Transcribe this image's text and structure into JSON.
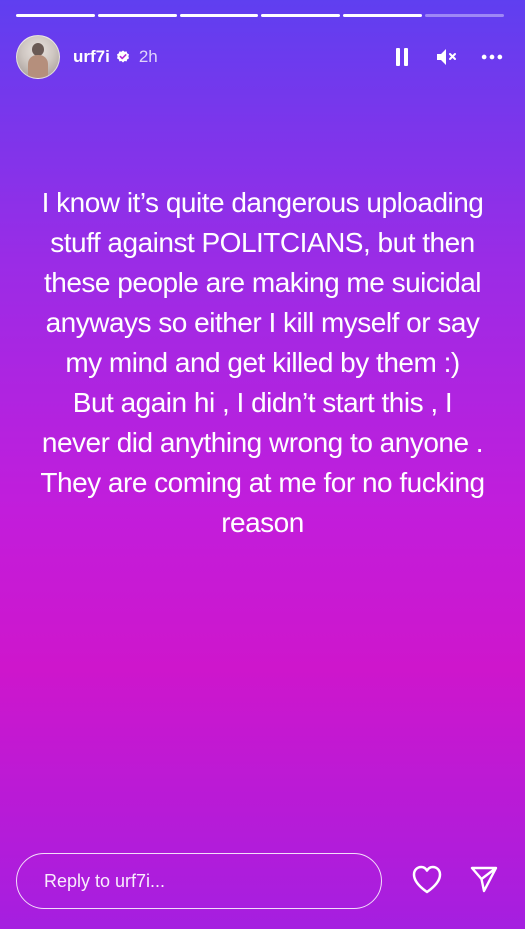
{
  "progress": {
    "segments_total": 6,
    "segments_done": 5
  },
  "header": {
    "username": "urf7i",
    "time_ago": "2h",
    "verified": true,
    "icons": [
      "pause-icon",
      "muted-speaker-icon",
      "more-icon"
    ]
  },
  "story": {
    "text": "I know it’s quite dangerous uploading\nstuff against POLITCIANS, but then\nthese people are making me suicidal\nanyways so either I kill myself or say\nmy mind and get killed by them :)\nBut again hi , I didn’t start this , I\nnever did anything wrong to anyone .\nThey are coming at me for no fucking\nreason",
    "background_gradient": [
      "#5f3ff0",
      "#9a2ce6",
      "#c21ddb",
      "#ce16cc",
      "#a51fe0"
    ]
  },
  "reply": {
    "placeholder": "Reply to urf7i...",
    "icons": [
      "heart-icon",
      "send-icon"
    ]
  },
  "colors": {
    "text": "#ffffff",
    "verified_badge": "#ffffff"
  }
}
